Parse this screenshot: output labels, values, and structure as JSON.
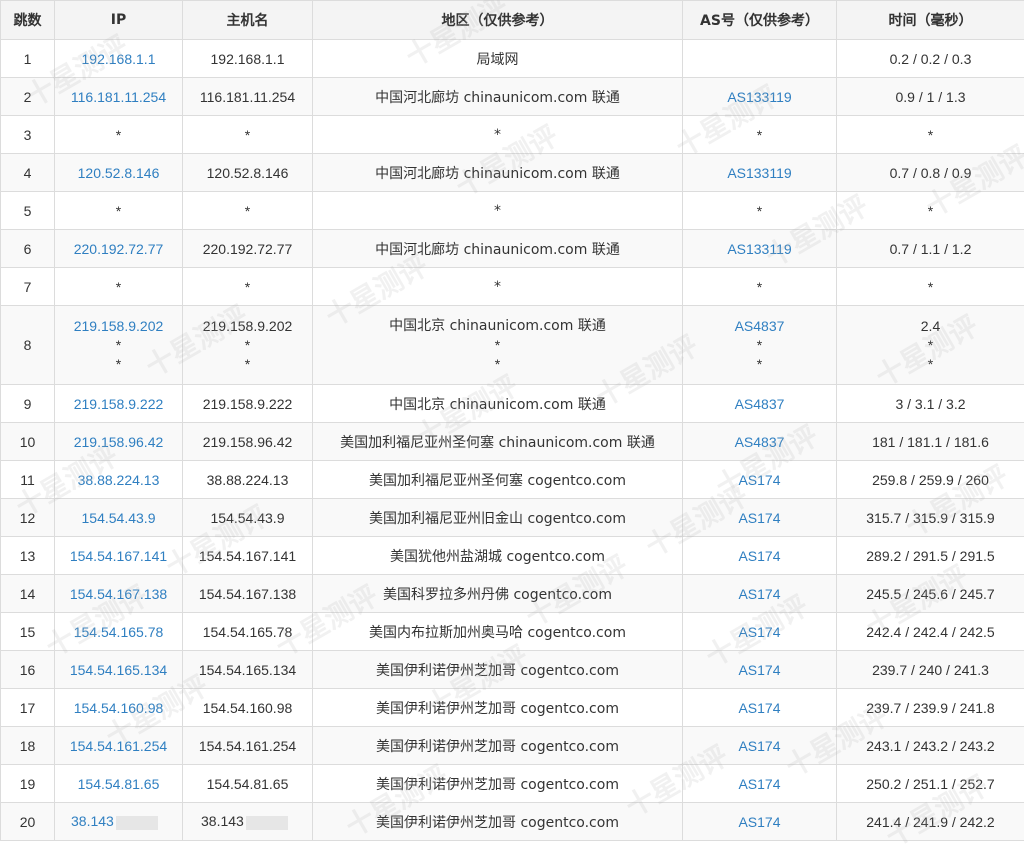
{
  "headers": {
    "hop": "跳数",
    "ip": "IP",
    "host": "主机名",
    "region": "地区（仅供参考）",
    "as": "AS号（仅供参考）",
    "time": "时间（毫秒）"
  },
  "watermark": "十星测评",
  "rows": [
    {
      "hop": "1",
      "ip": "192.168.1.1",
      "host": "192.168.1.1",
      "region": "局域网",
      "as": "",
      "time": "0.2 / 0.2 / 0.3"
    },
    {
      "hop": "2",
      "ip": "116.181.11.254",
      "host": "116.181.11.254",
      "region": "中国河北廊坊 chinaunicom.com 联通",
      "as": "AS133119",
      "time": "0.9 / 1 / 1.3"
    },
    {
      "hop": "3",
      "ip": "*",
      "host": "*",
      "region": "*",
      "as": "*",
      "time": "*"
    },
    {
      "hop": "4",
      "ip": "120.52.8.146",
      "host": "120.52.8.146",
      "region": "中国河北廊坊 chinaunicom.com 联通",
      "as": "AS133119",
      "time": "0.7 / 0.8 / 0.9"
    },
    {
      "hop": "5",
      "ip": "*",
      "host": "*",
      "region": "*",
      "as": "*",
      "time": "*"
    },
    {
      "hop": "6",
      "ip": "220.192.72.77",
      "host": "220.192.72.77",
      "region": "中国河北廊坊 chinaunicom.com 联通",
      "as": "AS133119",
      "time": "0.7 / 1.1 / 1.2"
    },
    {
      "hop": "7",
      "ip": "*",
      "host": "*",
      "region": "*",
      "as": "*",
      "time": "*"
    },
    {
      "hop": "8",
      "ip": "219.158.9.202",
      "host": "219.158.9.202",
      "region": "中国北京 chinaunicom.com 联通",
      "as": "AS4837",
      "time": "2.4",
      "extra": [
        "*",
        "*"
      ]
    },
    {
      "hop": "9",
      "ip": "219.158.9.222",
      "host": "219.158.9.222",
      "region": "中国北京 chinaunicom.com 联通",
      "as": "AS4837",
      "time": "3 / 3.1 / 3.2"
    },
    {
      "hop": "10",
      "ip": "219.158.96.42",
      "host": "219.158.96.42",
      "region": "美国加利福尼亚州圣何塞 chinaunicom.com 联通",
      "as": "AS4837",
      "time": "181 / 181.1 / 181.6"
    },
    {
      "hop": "11",
      "ip": "38.88.224.13",
      "host": "38.88.224.13",
      "region": "美国加利福尼亚州圣何塞 cogentco.com",
      "as": "AS174",
      "time": "259.8 / 259.9 / 260"
    },
    {
      "hop": "12",
      "ip": "154.54.43.9",
      "host": "154.54.43.9",
      "region": "美国加利福尼亚州旧金山 cogentco.com",
      "as": "AS174",
      "time": "315.7 / 315.9 / 315.9"
    },
    {
      "hop": "13",
      "ip": "154.54.167.141",
      "host": "154.54.167.141",
      "region": "美国犹他州盐湖城 cogentco.com",
      "as": "AS174",
      "time": "289.2 / 291.5 / 291.5"
    },
    {
      "hop": "14",
      "ip": "154.54.167.138",
      "host": "154.54.167.138",
      "region": "美国科罗拉多州丹佛 cogentco.com",
      "as": "AS174",
      "time": "245.5 / 245.6 / 245.7"
    },
    {
      "hop": "15",
      "ip": "154.54.165.78",
      "host": "154.54.165.78",
      "region": "美国内布拉斯加州奥马哈 cogentco.com",
      "as": "AS174",
      "time": "242.4 / 242.4 / 242.5"
    },
    {
      "hop": "16",
      "ip": "154.54.165.134",
      "host": "154.54.165.134",
      "region": "美国伊利诺伊州芝加哥 cogentco.com",
      "as": "AS174",
      "time": "239.7 / 240 / 241.3"
    },
    {
      "hop": "17",
      "ip": "154.54.160.98",
      "host": "154.54.160.98",
      "region": "美国伊利诺伊州芝加哥 cogentco.com",
      "as": "AS174",
      "time": "239.7 / 239.9 / 241.8"
    },
    {
      "hop": "18",
      "ip": "154.54.161.254",
      "host": "154.54.161.254",
      "region": "美国伊利诺伊州芝加哥 cogentco.com",
      "as": "AS174",
      "time": "243.1 / 243.2 / 243.2"
    },
    {
      "hop": "19",
      "ip": "154.54.81.65",
      "host": "154.54.81.65",
      "region": "美国伊利诺伊州芝加哥 cogentco.com",
      "as": "AS174",
      "time": "250.2 / 251.1 / 252.7"
    },
    {
      "hop": "20",
      "ip": "38.143",
      "host": "38.143",
      "region": "美国伊利诺伊州芝加哥 cogentco.com",
      "as": "AS174",
      "time": "241.4 / 241.9 / 242.2",
      "redacted": true
    }
  ]
}
